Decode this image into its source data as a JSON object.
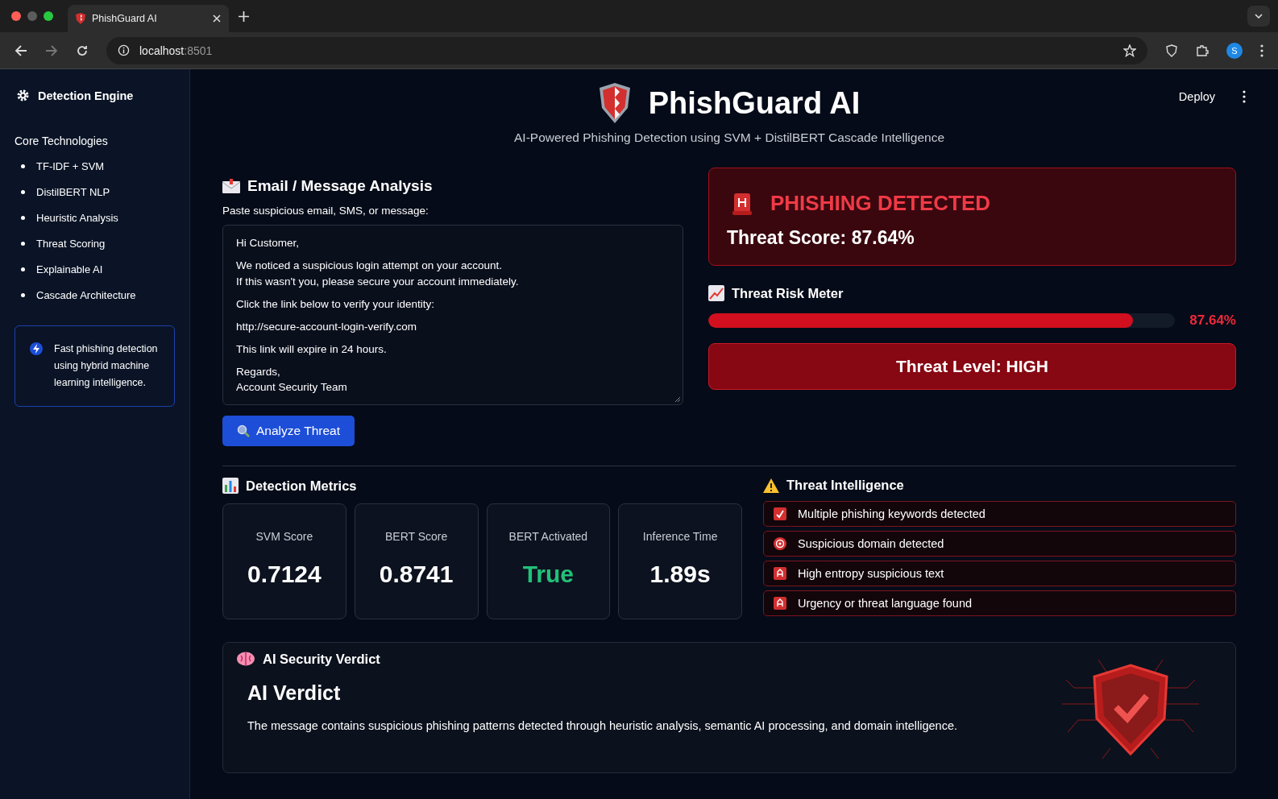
{
  "browser": {
    "tab_title": "PhishGuard AI",
    "url_host": "localhost",
    "url_port": ":8501",
    "avatar": "S"
  },
  "sidebar": {
    "title": "Detection Engine",
    "section": "Core Technologies",
    "items": [
      "TF-IDF + SVM",
      "DistilBERT NLP",
      "Heuristic Analysis",
      "Threat Scoring",
      "Explainable AI",
      "Cascade Architecture"
    ],
    "note": "Fast phishing detection using hybrid machine learning intelligence."
  },
  "header": {
    "title": "PhishGuard AI",
    "subtitle": "AI-Powered Phishing Detection using SVM + DistilBERT Cascade Intelligence",
    "deploy": "Deploy"
  },
  "analysis": {
    "title": "Email / Message Analysis",
    "label": "Paste suspicious email, SMS, or message:",
    "paragraphs": [
      "Hi Customer,",
      "We noticed a suspicious login attempt on your account.\nIf this wasn't you, please secure your account immediately.",
      "Click the link below to verify your identity:",
      "http://secure-account-login-verify.com",
      "This link will expire in 24 hours.",
      "Regards,\nAccount Security Team"
    ],
    "button": "Analyze Threat"
  },
  "result": {
    "verdict": "PHISHING DETECTED",
    "score": "Threat Score: 87.64%",
    "meter_title": "Threat Risk Meter",
    "level": 0.91,
    "reading": "87.64%",
    "threat_level": "Threat Level: HIGH"
  },
  "metrics": {
    "title": "Detection Metrics",
    "items": [
      {
        "label": "SVM Score",
        "value": "0.7124",
        "kind": "number"
      },
      {
        "label": "BERT Score",
        "value": "0.8741",
        "kind": "number"
      },
      {
        "label": "BERT Activated",
        "value": "True",
        "kind": "boolean"
      },
      {
        "label": "Inference Time",
        "value": "1.89s",
        "kind": "number"
      }
    ]
  },
  "intelligence": {
    "title": "Threat Intelligence",
    "items": [
      {
        "text": "Multiple phishing keywords detected",
        "kind": "check"
      },
      {
        "text": "Suspicious domain detected",
        "kind": "target"
      },
      {
        "text": "High entropy suspicious text",
        "kind": "alert"
      },
      {
        "text": "Urgency or threat language found",
        "kind": "alert"
      }
    ]
  },
  "verdict": {
    "section": "AI Security Verdict",
    "title": "AI Verdict",
    "text": "The message contains suspicious phishing patterns detected through heuristic analysis, semantic AI processing, and domain intelligence."
  }
}
